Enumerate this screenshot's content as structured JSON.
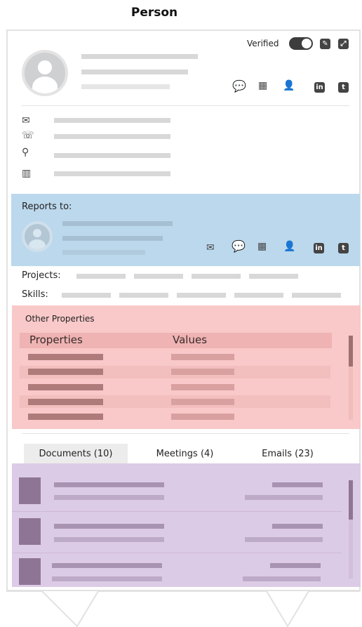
{
  "page_title": "Person",
  "header": {
    "verified_label": "Verified"
  },
  "reports_to": {
    "label": "Reports to:"
  },
  "meta": {
    "projects_label": "Projects:",
    "skills_label": "Skills:"
  },
  "other_properties": {
    "title": "Other Properties",
    "col_properties": "Properties",
    "col_values": "Values"
  },
  "tabs": [
    {
      "label": "Documents (10)",
      "active": true
    },
    {
      "label": "Meetings (4)",
      "active": false
    },
    {
      "label": "Emails (23)",
      "active": false
    }
  ],
  "colors": {
    "reports_bg": "#bcd8ec",
    "properties_bg": "#f9c8c8",
    "documents_bg": "#dccbe6"
  },
  "icons": [
    "chat-icon",
    "calendar-icon",
    "add-user-icon",
    "linkedin-icon",
    "twitter-icon",
    "edit-icon",
    "expand-icon",
    "mail-icon",
    "phone-icon",
    "location-icon",
    "building-icon"
  ]
}
